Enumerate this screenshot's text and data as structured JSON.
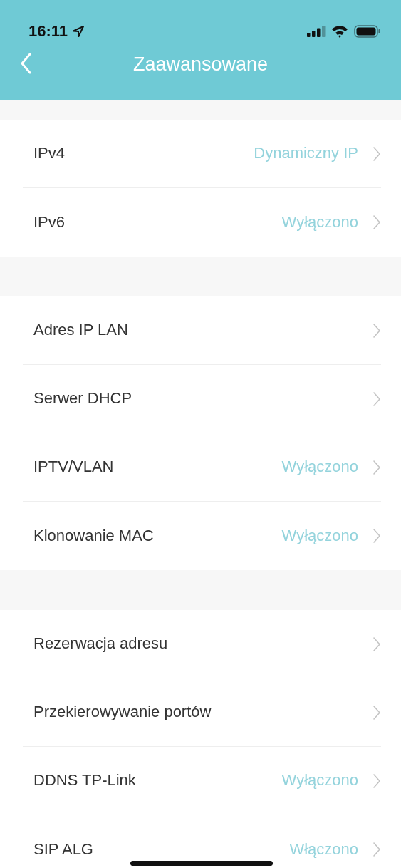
{
  "status_bar": {
    "time": "16:11"
  },
  "nav": {
    "title": "Zaawansowane"
  },
  "groups": [
    {
      "rows": [
        {
          "label": "IPv4",
          "value": "Dynamiczny IP"
        },
        {
          "label": "IPv6",
          "value": "Wyłączono"
        }
      ]
    },
    {
      "rows": [
        {
          "label": "Adres IP LAN"
        },
        {
          "label": "Serwer DHCP"
        },
        {
          "label": "IPTV/VLAN",
          "value": "Wyłączono"
        },
        {
          "label": "Klonowanie MAC",
          "value": "Wyłączono"
        }
      ]
    },
    {
      "rows": [
        {
          "label": "Rezerwacja adresu"
        },
        {
          "label": "Przekierowywanie portów"
        },
        {
          "label": "DDNS TP-Link",
          "value": "Wyłączono"
        },
        {
          "label": "SIP ALG",
          "value": "Włączono"
        }
      ]
    }
  ]
}
